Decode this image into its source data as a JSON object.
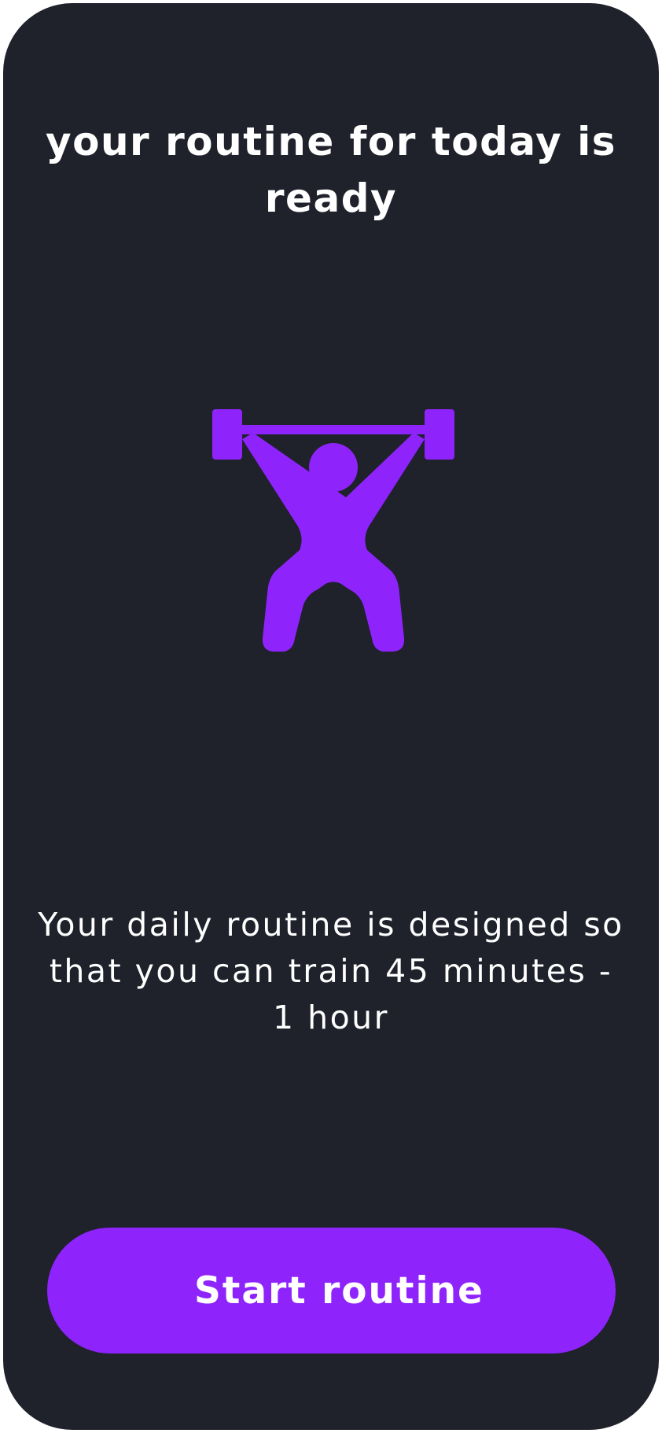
{
  "screen": {
    "title": "your routine for today is ready",
    "hero_icon": "weightlifter-icon",
    "description": "Your daily routine is designed so that you can train 45 minutes - 1 hour",
    "cta_label": "Start routine"
  },
  "colors": {
    "background": "#1f212b",
    "accent": "#8e24fb",
    "text": "#ffffff"
  }
}
